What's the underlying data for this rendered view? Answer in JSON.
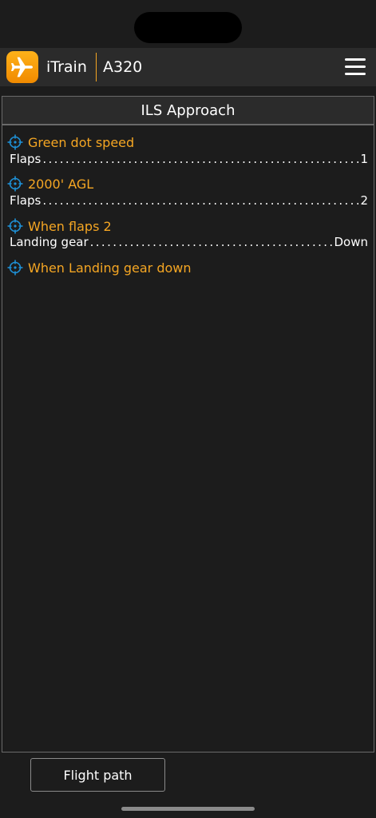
{
  "header": {
    "app_name": "iTrain",
    "aircraft": "A320",
    "icon": "airplane-icon",
    "menu_icon": "hamburger-menu-icon"
  },
  "checklist": {
    "title": "ILS Approach",
    "items": [
      {
        "heading": "Green dot speed",
        "action": {
          "label": "Flaps",
          "value": "1"
        }
      },
      {
        "heading": "2000' AGL",
        "action": {
          "label": "Flaps",
          "value": "2"
        }
      },
      {
        "heading": "When flaps 2",
        "action": {
          "label": "Landing gear",
          "value": "Down"
        }
      },
      {
        "heading": "When Landing gear down"
      }
    ]
  },
  "footer": {
    "flight_path_label": "Flight path"
  },
  "colors": {
    "accent": "#f5a623",
    "target_icon": "#1e90d6",
    "background": "#1c1c1c",
    "header_bg": "#2b2b2b"
  }
}
